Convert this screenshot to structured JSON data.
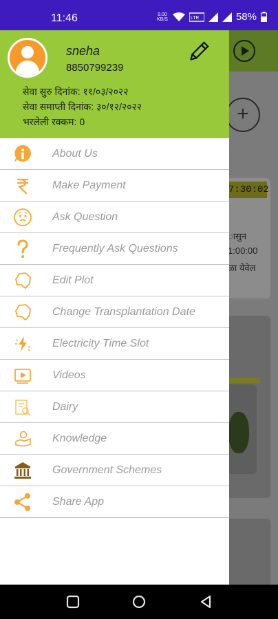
{
  "status_bar": {
    "time": "11:46",
    "data_speed": "9.00 KB/S",
    "battery": "58%"
  },
  "drawer": {
    "user": {
      "name": "sneha",
      "phone": "8850799239"
    },
    "info": {
      "start_date": "सेवा सुरु दिनांक: ११/०३/२०२२",
      "end_date": "सेवा समाप्ती दिनांक: ३०/१२/२०२२",
      "amount_paid": "भरलेली रक्कम: 0"
    },
    "menu": [
      {
        "label": "About Us",
        "icon": "info-icon"
      },
      {
        "label": "Make Payment",
        "icon": "rupee-icon"
      },
      {
        "label": "Ask Question",
        "icon": "thinking-face-icon"
      },
      {
        "label": "Frequently Ask Questions",
        "icon": "question-mark-icon"
      },
      {
        "label": "Edit Plot",
        "icon": "plot-outline-icon"
      },
      {
        "label": "Change Transplantation Date",
        "icon": "plot-outline-icon"
      },
      {
        "label": "Electricity Time Slot",
        "icon": "lightning-icon"
      },
      {
        "label": "Videos",
        "icon": "video-icon"
      },
      {
        "label": "Dairy",
        "icon": "diary-icon"
      },
      {
        "label": "Knowledge",
        "icon": "knowledge-icon"
      },
      {
        "label": "Government Schemes",
        "icon": "government-building-icon"
      },
      {
        "label": "Share App",
        "icon": "share-icon"
      }
    ]
  },
  "background": {
    "timer": "7:30:02",
    "text_lines": [
      "ासुन",
      "1:00:00",
      "ळा येवेल"
    ]
  },
  "colors": {
    "status_bar": "#3d1bbf",
    "header": "#97c93b",
    "accent_orange": "#f79a2c",
    "menu_text": "#9a9a9a"
  }
}
